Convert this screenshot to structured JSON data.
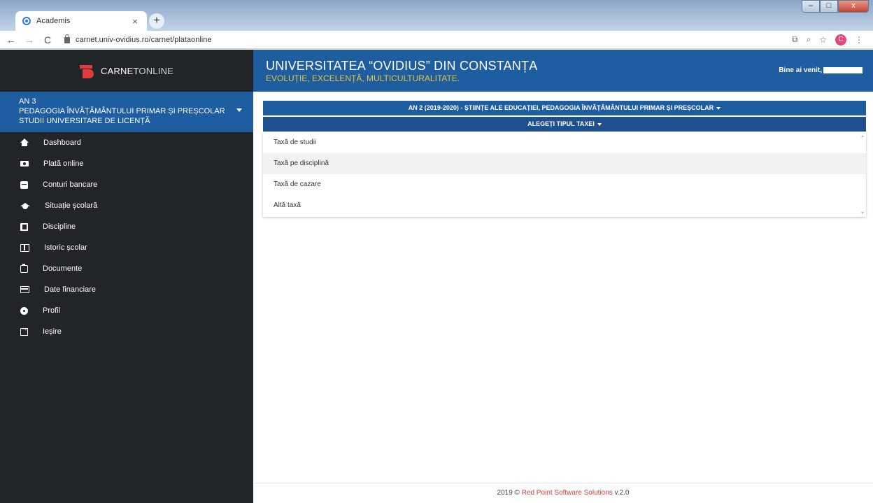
{
  "browser": {
    "tab_title": "Academis",
    "tab_close": "×",
    "new_tab": "+",
    "back": "←",
    "forward": "→",
    "reload": "C",
    "url": "carnet.univ-ovidius.ro/carnet/plataonline",
    "translate_icon": "⧉",
    "zoom_icon": "⌕",
    "bookmark_icon": "☆",
    "profile_initial": "C",
    "menu_icon": "⋮",
    "win_min": "–",
    "win_max": "□",
    "win_close": "x"
  },
  "sidebar": {
    "brand_bold": "CARNET",
    "brand_thin": "ONLINE",
    "program": {
      "year": "AN 3",
      "specialization": "PEDAGOGIA ÎNVĂȚĂMÂNTULUI PRIMAR ȘI PREȘCOLAR",
      "level": "STUDII UNIVERSITARE DE LICENȚĂ"
    },
    "items": [
      {
        "label": "Dashboard",
        "icon": "home-icon"
      },
      {
        "label": "Plată online",
        "icon": "money-icon"
      },
      {
        "label": "Conturi bancare",
        "icon": "bank-icon"
      },
      {
        "label": "Situație școlară",
        "icon": "graduation-cap-icon"
      },
      {
        "label": "Discipline",
        "icon": "book-icon"
      },
      {
        "label": "Istoric școlar",
        "icon": "open-book-icon"
      },
      {
        "label": "Documente",
        "icon": "clipboard-icon"
      },
      {
        "label": "Date financiare",
        "icon": "credit-card-icon"
      },
      {
        "label": "Profil",
        "icon": "gear-icon"
      },
      {
        "label": "Ieșire",
        "icon": "exit-icon"
      }
    ]
  },
  "header": {
    "university": "UNIVERSITATEA “OVIDIUS” DIN CONSTANȚA",
    "motto": "EVOLUȚIE, EXCELENȚĂ, MULTICULTURALITATE.",
    "welcome": "Bine ai venit,"
  },
  "main": {
    "year_selector": "AN 2 (2019-2020) - ȘTIINȚE ALE EDUCAȚIEI, PEDAGOGIA ÎNVĂȚĂMÂNTULUI PRIMAR ȘI PREȘCOLAR",
    "fee_type_selector": "ALEGEȚI TIPUL TAXEI",
    "fee_options": [
      "Taxă de studii",
      "Taxă pe disciplină",
      "Taxă de cazare",
      "Altă taxă"
    ]
  },
  "footer": {
    "prefix": "2019 © ",
    "company": "Red Point Software Solutions",
    "version": " v.2.0"
  },
  "colors": {
    "primary_blue": "#1e5da0",
    "sidebar_dark": "#222527",
    "motto_gold": "#e5c43e",
    "brand_red": "#e23b3b"
  }
}
